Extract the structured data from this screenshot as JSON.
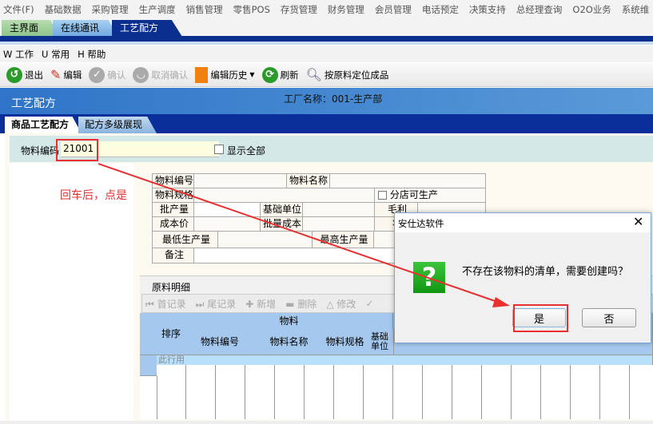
{
  "menubar": [
    "文件(F)",
    "基础数据",
    "采购管理",
    "生产调度",
    "销售管理",
    "零售POS",
    "存货管理",
    "财务管理",
    "会员管理",
    "电话预定",
    "决策支持",
    "总经理查询",
    "O2O业务",
    "系统维"
  ],
  "main_tabs": [
    "主界面",
    "在线通讯",
    "工艺配方"
  ],
  "menu2": [
    "W 工作",
    "U 常用",
    "H 帮助"
  ],
  "toolbar": {
    "exit": "退出",
    "edit": "编辑",
    "confirm": "确认",
    "cancel_confirm": "取消确认",
    "edit_history": "编辑历史",
    "refresh": "刷新",
    "locate": "按原料定位成品"
  },
  "header": {
    "title": "工艺配方",
    "factory": "工厂名称：001-生产部"
  },
  "sub_tabs": [
    "商品工艺配方",
    "配方多级展现"
  ],
  "search": {
    "label": "物料编码",
    "value": "21001",
    "show_all": "显示全部"
  },
  "annotation": "回车后，点是",
  "form": {
    "code": "物料编号",
    "name": "物料名称",
    "spec": "物料规格",
    "branch": "分店可生产",
    "batch_qty": "批产量",
    "base_unit": "基础单位",
    "gross": "毛利",
    "cost": "成本价",
    "batch_cost": "批量成本",
    "status": "状",
    "min_qty": "最低生产量",
    "max_qty": "最高生产量",
    "note": "备注"
  },
  "grid": {
    "title": "原料明细",
    "tools": [
      "首记录",
      "尾记录",
      "新增",
      "删除",
      "修改"
    ],
    "headers": {
      "order": "排序",
      "material": "物料",
      "code": "物料编号",
      "name": "物料名称",
      "spec": "物料规格",
      "unit": "基础\n单位"
    },
    "new_row_hint": "此行用"
  },
  "dialog": {
    "title": "安仕达软件",
    "message": "不存在该物料的清单，需要创建吗？",
    "yes": "是",
    "no": "否"
  },
  "colors": {
    "accent": "#0a2f8f",
    "highlight": "#e83030"
  }
}
